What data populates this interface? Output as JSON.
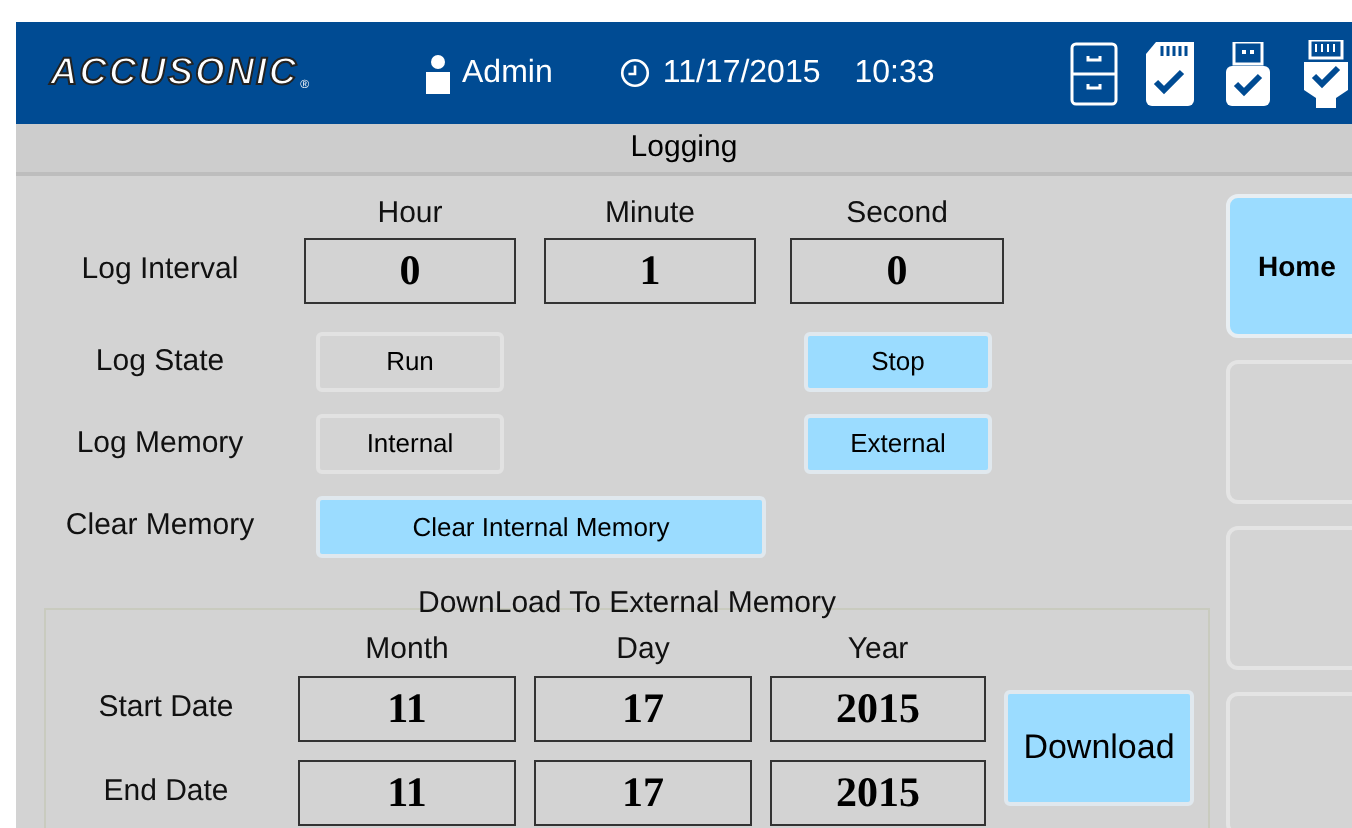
{
  "header": {
    "logo": "ACCUSONIC",
    "logo_mark": "®",
    "user": "Admin",
    "date": "11/17/2015",
    "time": "10:33"
  },
  "title": "Logging",
  "log_interval": {
    "label": "Log Interval",
    "columns": [
      "Hour",
      "Minute",
      "Second"
    ],
    "values": [
      "0",
      "1",
      "0"
    ]
  },
  "log_state": {
    "label": "Log State",
    "options": [
      {
        "label": "Run",
        "selected": false
      },
      {
        "label": "Stop",
        "selected": true
      }
    ]
  },
  "log_memory": {
    "label": "Log Memory",
    "options": [
      {
        "label": "Internal",
        "selected": false
      },
      {
        "label": "External",
        "selected": true
      }
    ]
  },
  "clear_memory": {
    "label": "Clear Memory",
    "button": "Clear Internal Memory"
  },
  "download": {
    "title": "DownLoad To External Memory",
    "columns": [
      "Month",
      "Day",
      "Year"
    ],
    "rows": [
      {
        "label": "Start Date",
        "values": [
          "11",
          "17",
          "2015"
        ]
      },
      {
        "label": "End Date",
        "values": [
          "11",
          "17",
          "2015"
        ]
      }
    ],
    "button": "Download"
  },
  "nav": [
    {
      "kind": "labeled",
      "label": "Home",
      "selected": true
    },
    {
      "kind": "blank",
      "selected": false
    },
    {
      "kind": "blank",
      "selected": false
    },
    {
      "kind": "blank",
      "selected": false
    }
  ]
}
